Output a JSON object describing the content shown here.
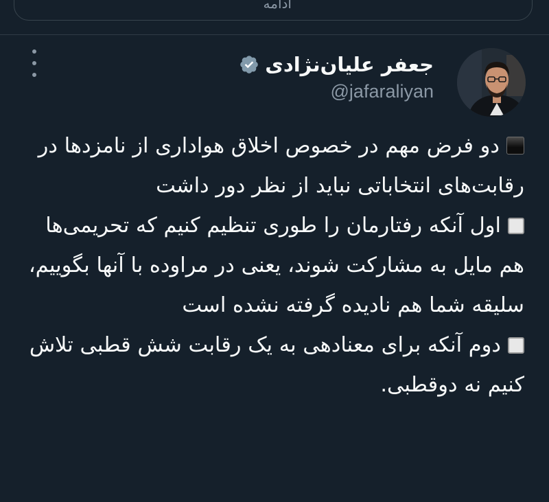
{
  "previous_card": {
    "text": "ادامه"
  },
  "tweet": {
    "author": {
      "display_name": "جعفر علیان‌نژادی",
      "handle": "@jafaraliyan",
      "verified": true
    },
    "more_icon": "more-vertical-icon",
    "verified_icon": "verified-badge-icon",
    "paragraphs": [
      {
        "bullet": "black-square",
        "text": "دو فرض مهم در خصوص اخلاق هواداری از نامزدها در رقابت‌های انتخاباتی نباید از نظر دور داشت"
      },
      {
        "bullet": "white-square",
        "text": "اول آنکه رفتارمان را طوری تنظیم کنیم که تحریمی‌ها هم مایل به مشارکت شوند، یعنی در مراوده با آنها بگوییم، سلیقه شما هم نادیده گرفته نشده است"
      },
      {
        "bullet": "white-square",
        "text": "دوم آنکه برای معنادهی به یک رقابت شش قطبی تلاش کنیم نه دوقطبی."
      }
    ]
  },
  "colors": {
    "background": "#15202b",
    "text_primary": "#f7f9f9",
    "text_secondary": "#8b98a5",
    "border": "#38444d",
    "verified_badge": "#829aab"
  }
}
